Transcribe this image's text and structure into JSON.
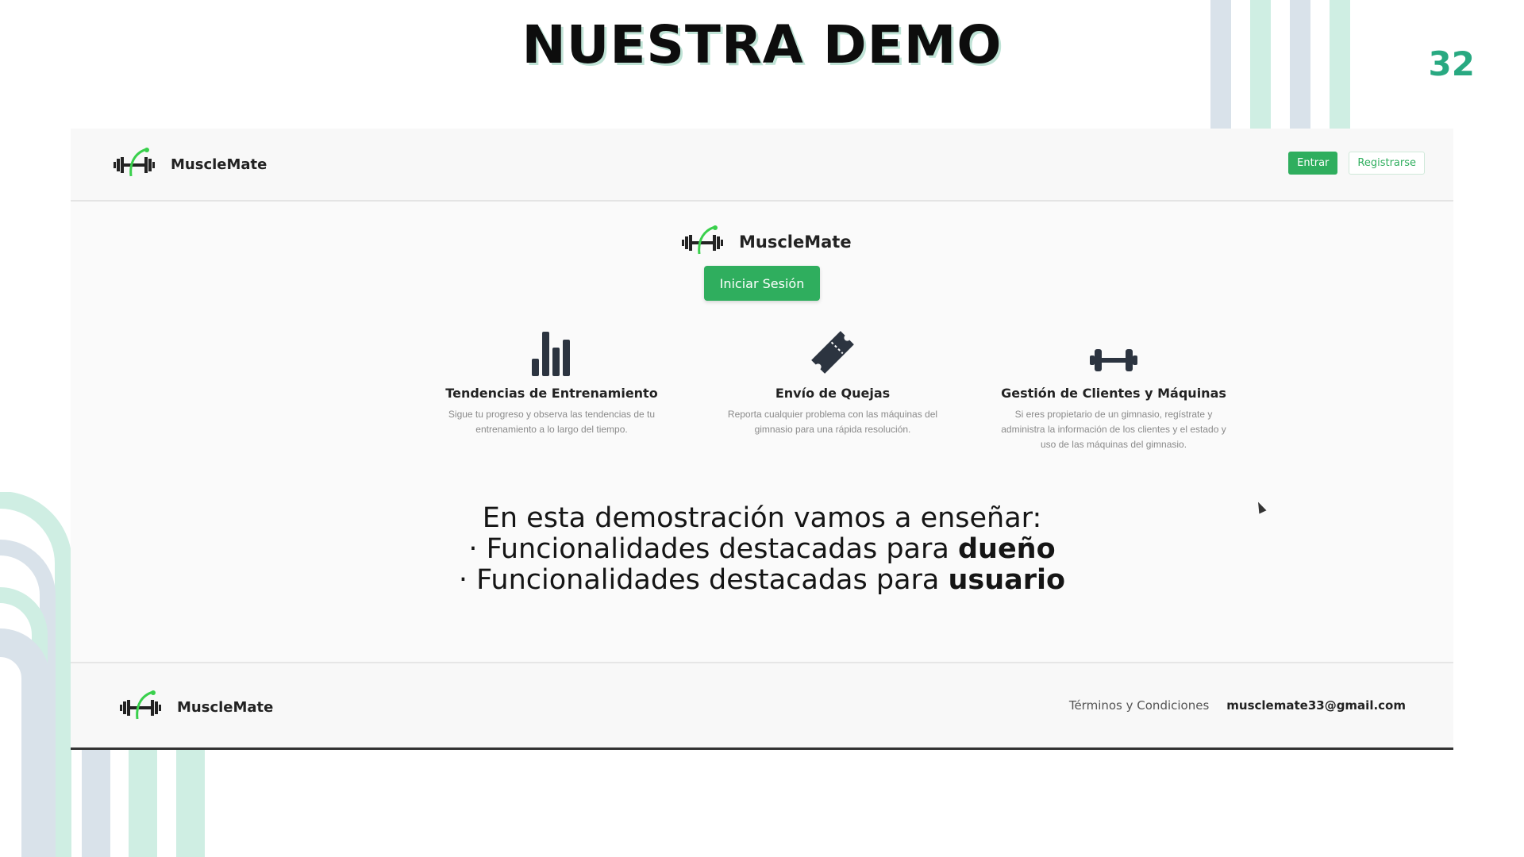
{
  "slide": {
    "title": "NUESTRA DEMO",
    "page_number": "32",
    "accent_color": "#28a981"
  },
  "navbar": {
    "brand": "MuscleMate",
    "login_button": "Entrar",
    "register_button": "Registrarse"
  },
  "hero": {
    "brand": "MuscleMate",
    "login_button": "Iniciar Sesión"
  },
  "features": [
    {
      "icon": "bar-chart-icon",
      "title": "Tendencias de Entrenamiento",
      "description": "Sigue tu progreso y observa las tendencias de tu entrenamiento a lo largo del tiempo."
    },
    {
      "icon": "ticket-icon",
      "title": "Envío de Quejas",
      "description": "Reporta cualquier problema con las máquinas del gimnasio para una rápida resolución."
    },
    {
      "icon": "dumbbell-icon",
      "title": "Gestión de Clientes y Máquinas",
      "description": "Si eres propietario de un gimnasio, regístrate y administra la información de los clientes y el estado y uso de las máquinas del gimnasio."
    }
  ],
  "demo": {
    "intro": "En esta demostración vamos a enseñar:",
    "items": [
      {
        "bullet": "·",
        "text": "Funcionalidades destacadas para ",
        "bold": "dueño"
      },
      {
        "bullet": "·",
        "text": "Funcionalidades destacadas para ",
        "bold": "usuario"
      }
    ]
  },
  "footer": {
    "brand": "MuscleMate",
    "terms_link": "Términos y Condiciones",
    "email": "musclemate33@gmail.com"
  },
  "colors": {
    "brand_green": "#2fae5e",
    "deco_mint": "#cfeee3",
    "deco_blue": "#d9e2ea"
  }
}
